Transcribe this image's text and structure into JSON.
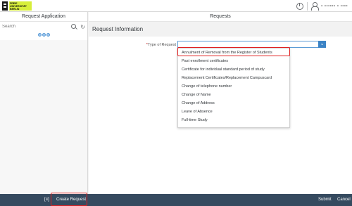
{
  "header": {
    "logo_text": "FREIE UNIVERSITÄT BERLIN",
    "user_name": "▪ ▪▪▪▪▪▪ ▪ ▪▪▪▪"
  },
  "master": {
    "title": "Request Application",
    "search_placeholder": "Search"
  },
  "detail": {
    "title": "Requests",
    "section": "Request Information",
    "type_label": "Type of Request",
    "required_mark": "*",
    "select_value": ""
  },
  "dropdown": {
    "options": [
      "Annulment of Removal from the Register of Students",
      "Past enrollment certificates",
      "Certificate for individual standard period of study",
      "Replacement Certificates/Replacement Campuscard",
      "Change of telephone number",
      "Change of Name",
      "Change of Address",
      "Leave of Absence",
      "Full-time Study"
    ]
  },
  "footer": {
    "message_indicator": "[≡]",
    "create_label": "Create Request",
    "submit_label": "Submit",
    "cancel_label": "Cancel"
  },
  "colors": {
    "accent": "#3b83c5",
    "footer_bg": "#354a5f",
    "highlight": "#e02020",
    "logo_bg": "#d7ee3a"
  }
}
